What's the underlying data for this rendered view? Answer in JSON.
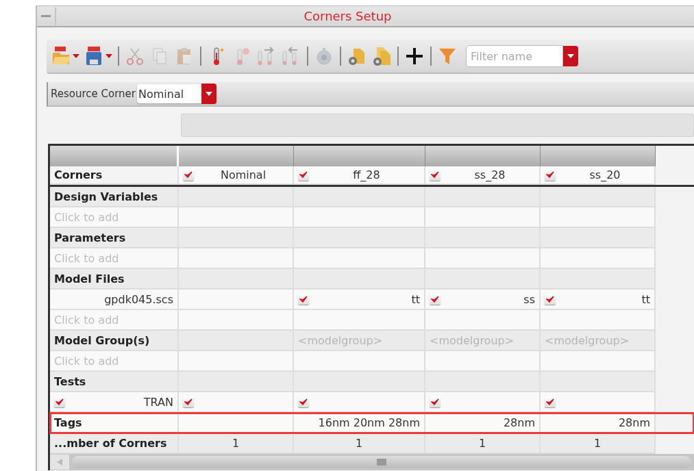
{
  "window": {
    "title": "Corners Setup"
  },
  "toolbar": {
    "buttons": [
      {
        "kind": "csv-open",
        "disabled": false,
        "dropdown": true
      },
      {
        "kind": "csv-save",
        "disabled": false,
        "dropdown": true
      },
      {
        "kind": "separator"
      },
      {
        "kind": "cut",
        "disabled": true
      },
      {
        "kind": "copy",
        "disabled": true
      },
      {
        "kind": "paste",
        "disabled": true
      },
      {
        "kind": "separator"
      },
      {
        "kind": "thermometer-new",
        "disabled": false
      },
      {
        "kind": "thermometer-delete",
        "disabled": true
      },
      {
        "kind": "thermometer-right",
        "disabled": true
      },
      {
        "kind": "thermometer-left",
        "disabled": true
      },
      {
        "kind": "separator"
      },
      {
        "kind": "stopwatch",
        "disabled": true
      },
      {
        "kind": "separator"
      },
      {
        "kind": "gear-folder",
        "disabled": false
      },
      {
        "kind": "gear-folders",
        "disabled": false
      },
      {
        "kind": "separator"
      },
      {
        "kind": "plus",
        "disabled": false
      },
      {
        "kind": "separator"
      },
      {
        "kind": "filter",
        "disabled": false
      }
    ],
    "filter": {
      "placeholder": "Filter name"
    }
  },
  "resource_corner": {
    "label": "Resource Corner",
    "value": "Nominal"
  },
  "table": {
    "rows": [
      {
        "kind": "corners",
        "label": "Corners",
        "cells": [
          {
            "kind": "check",
            "checked": true,
            "text": "Nominal"
          },
          {
            "kind": "check",
            "checked": true,
            "text": "ff_28"
          },
          {
            "kind": "check",
            "checked": true,
            "text": "ss_28"
          },
          {
            "kind": "check",
            "checked": true,
            "text": "ss_20"
          }
        ]
      },
      {
        "kind": "section",
        "label": "Design Variables"
      },
      {
        "kind": "add",
        "label": "Click to add"
      },
      {
        "kind": "section",
        "label": "Parameters"
      },
      {
        "kind": "add",
        "label": "Click to add"
      },
      {
        "kind": "section",
        "label": "Model Files"
      },
      {
        "kind": "item",
        "label": "gpdk045.scs",
        "cells": [
          {
            "kind": "empty"
          },
          {
            "kind": "check",
            "checked": true,
            "text": "tt"
          },
          {
            "kind": "check",
            "checked": true,
            "text": "ss"
          },
          {
            "kind": "check",
            "checked": true,
            "text": "tt"
          }
        ]
      },
      {
        "kind": "add",
        "label": "Click to add"
      },
      {
        "kind": "section",
        "label": "Model Group(s)",
        "cells": [
          {
            "kind": "empty"
          },
          {
            "kind": "hint",
            "text": "<modelgroup>"
          },
          {
            "kind": "hint",
            "text": "<modelgroup>"
          },
          {
            "kind": "hint",
            "text": "<modelgroup>"
          }
        ]
      },
      {
        "kind": "add",
        "label": "Click to add"
      },
      {
        "kind": "section",
        "label": "Tests"
      },
      {
        "kind": "item",
        "label": "TRAN",
        "checked": true,
        "cells": [
          {
            "kind": "check",
            "checked": true
          },
          {
            "kind": "check",
            "checked": true
          },
          {
            "kind": "check",
            "checked": true
          },
          {
            "kind": "check",
            "checked": true
          }
        ]
      },
      {
        "kind": "section",
        "label": "Tags",
        "highlighted": true,
        "cells": [
          {
            "kind": "empty"
          },
          {
            "kind": "text",
            "text": "16nm 20nm 28nm"
          },
          {
            "kind": "text",
            "text": "28nm"
          },
          {
            "kind": "text",
            "text": "28nm"
          }
        ]
      },
      {
        "kind": "section",
        "label": "...mber of Corners",
        "cells": [
          {
            "kind": "center",
            "text": "1"
          },
          {
            "kind": "center",
            "text": "1"
          },
          {
            "kind": "center",
            "text": "1"
          },
          {
            "kind": "center",
            "text": "1"
          }
        ]
      }
    ]
  }
}
